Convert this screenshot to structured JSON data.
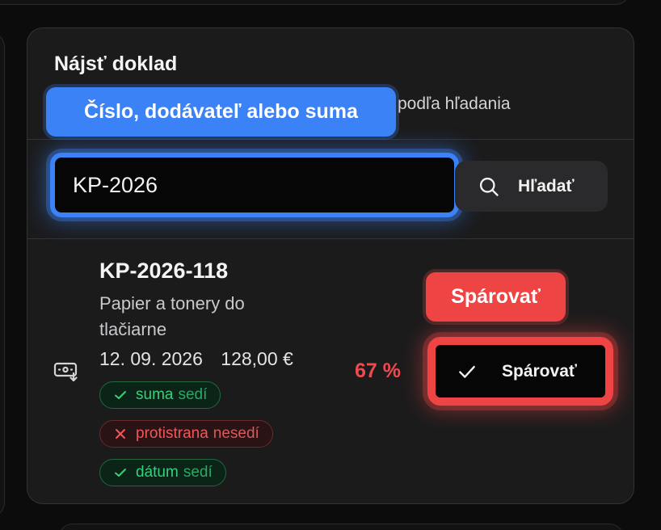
{
  "card": {
    "title": "Nájsť doklad",
    "subtitle_visible": "podľa hľadania"
  },
  "search": {
    "value": "KP-2026",
    "button_label": "Hľadať",
    "button_icon": "search-icon"
  },
  "tooltips": {
    "input_label": "Číslo, dodávateľ alebo suma",
    "match_label": "Spárovať"
  },
  "result": {
    "icon": "receipt-icon",
    "code": "KP-2026-118",
    "description": "Papier a tonery do tlačiarne",
    "date": "12. 09. 2026",
    "amount": "128,00 €",
    "match_percent": "67 %",
    "match_button_label": "Spárovať",
    "match_button_icon": "check-icon",
    "checks": [
      {
        "key": "suma",
        "value": "sedí",
        "status": "ok"
      },
      {
        "key": "protistrana",
        "value": "nesedí",
        "status": "bad"
      },
      {
        "key": "dátum",
        "value": "sedí",
        "status": "ok"
      }
    ]
  },
  "colors": {
    "accent_blue": "#3b82f6",
    "accent_red": "#ef4444",
    "ok_green": "#34d07c",
    "bad_red": "#f0575a"
  }
}
